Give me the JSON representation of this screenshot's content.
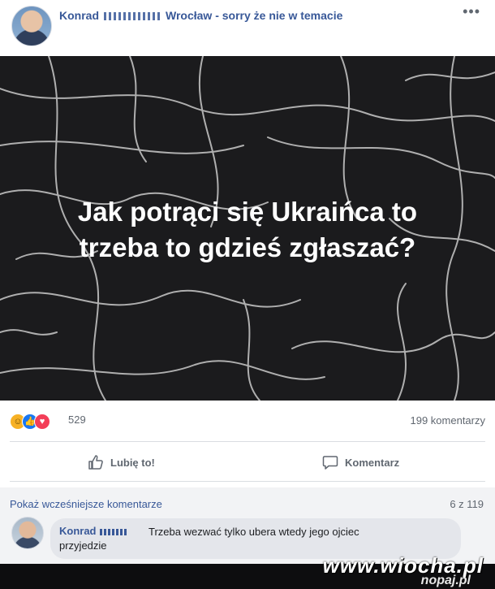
{
  "header": {
    "author_first": "Konrad",
    "location_text": "Wrocław - sorry że nie w temacie",
    "more_icon": "more-dots-icon"
  },
  "image": {
    "quote_line1": "Jak potrąci się Ukraińca to",
    "quote_line2": "trzeba to gdzieś zgłaszać?"
  },
  "stats": {
    "reaction_icons": [
      "haha-icon",
      "like-icon",
      "love-icon"
    ],
    "reaction_count": "529",
    "comment_count": "199 komentarzy"
  },
  "actions": {
    "like_label": "Lubię to!",
    "comment_label": "Komentarz"
  },
  "comments": {
    "prev_label": "Pokaż wcześniejsze komentarze",
    "page_label": "6 z 119",
    "items": [
      {
        "author_first": "Konrad",
        "text": "Trzeba wezwać tylko ubera wtedy jego ojciec przyjedzie"
      }
    ]
  },
  "watermark": {
    "text": "www.wiocha.pl",
    "sub": "nopaj.pl"
  },
  "colors": {
    "link": "#385898",
    "image_bg": "#1b1b1d",
    "comment_bg": "#f2f3f5"
  }
}
